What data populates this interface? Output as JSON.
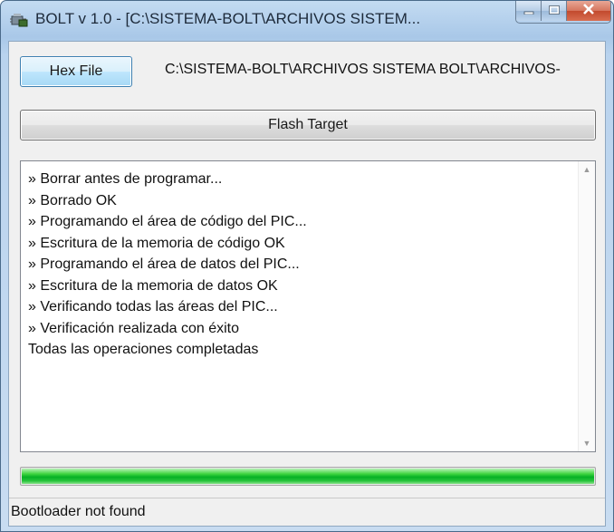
{
  "window": {
    "title": "BOLT v 1.0 - [C:\\SISTEMA-BOLT\\ARCHIVOS SISTEM...",
    "minimize_icon": "minimize-icon",
    "maximize_icon": "maximize-icon",
    "close_icon": "close-icon",
    "app_icon": "bolt-app-icon"
  },
  "toolbar": {
    "hex_file_label": "Hex File",
    "file_path": "C:\\SISTEMA-BOLT\\ARCHIVOS SISTEMA BOLT\\ARCHIVOS-",
    "flash_target_label": "Flash Target"
  },
  "log": {
    "lines": [
      "» Borrar antes de programar...",
      "» Borrado OK",
      "» Programando el área de código del PIC...",
      "» Escritura de la memoria de código OK",
      "» Programando el área de datos del PIC...",
      "» Escritura de la memoria de datos OK",
      "» Verificando todas las áreas del PIC...",
      "» Verificación realizada con éxito",
      "Todas las operaciones completadas"
    ]
  },
  "progress": {
    "fraction": 1.0,
    "color": "#06b025"
  },
  "status": {
    "text": "Bootloader not found"
  },
  "colors": {
    "accent": "#3c7fb1",
    "titlebar": "#b9d3ee",
    "close": "#c24a2e"
  }
}
